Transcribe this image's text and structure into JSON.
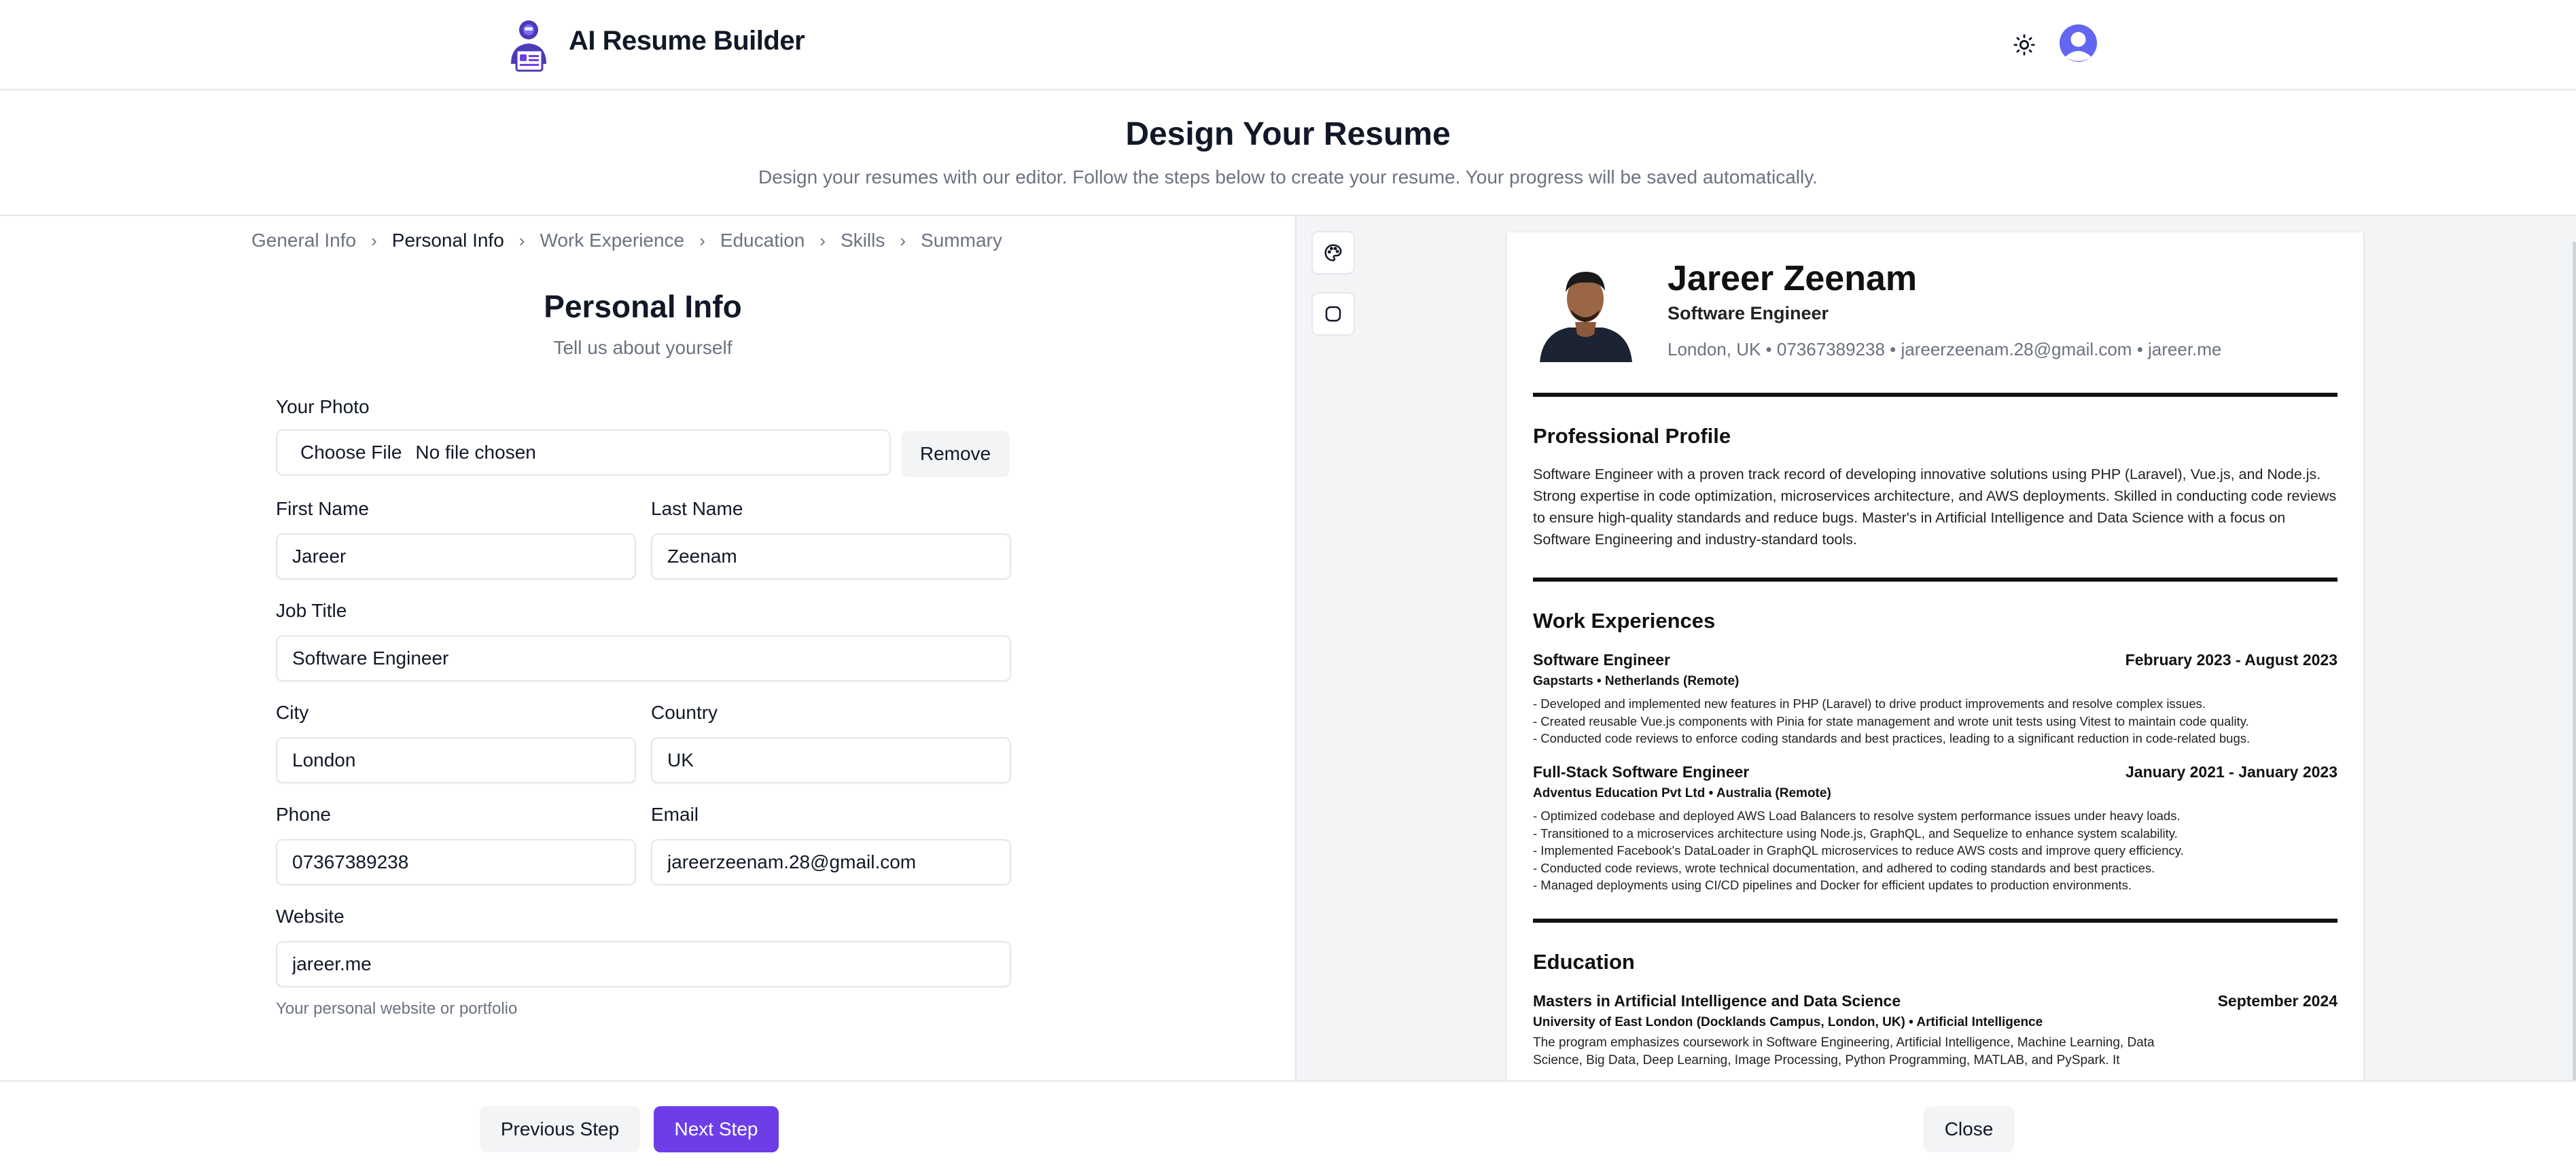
{
  "app": {
    "title": "AI Resume Builder",
    "accent_color": "#6d3ee8",
    "logo_icon": "robot-resume-logo",
    "theme_icon": "sun-icon",
    "avatar_icon": "user-avatar-icon"
  },
  "page": {
    "title": "Design Your Resume",
    "subtitle": "Design your resumes with our editor. Follow the steps below to create your resume. Your progress will be saved automatically."
  },
  "steps": [
    {
      "label": "General Info",
      "active": false
    },
    {
      "label": "Personal Info",
      "active": true
    },
    {
      "label": "Work Experience",
      "active": false
    },
    {
      "label": "Education",
      "active": false
    },
    {
      "label": "Skills",
      "active": false
    },
    {
      "label": "Summary",
      "active": false
    }
  ],
  "step_separator": "›",
  "form": {
    "title": "Personal Info",
    "subtitle": "Tell us about yourself",
    "photo_label": "Your Photo",
    "choose_file": "Choose File",
    "no_file": "No file chosen",
    "remove": "Remove",
    "first_name_label": "First Name",
    "first_name": "Jareer",
    "last_name_label": "Last Name",
    "last_name": "Zeenam",
    "job_title_label": "Job Title",
    "job_title": "Software Engineer",
    "city_label": "City",
    "city": "London",
    "country_label": "Country",
    "country": "UK",
    "phone_label": "Phone",
    "phone": "07367389238",
    "email_label": "Email",
    "email": "jareerzeenam.28@gmail.com",
    "website_label": "Website",
    "website": "jareer.me",
    "website_hint": "Your personal website or portfolio"
  },
  "preview_tools": [
    {
      "icon": "palette-icon"
    },
    {
      "icon": "square-rounded-icon"
    }
  ],
  "resume": {
    "name": "Jareer Zeenam",
    "job_title": "Software Engineer",
    "contact": "London, UK • 07367389238 • jareerzeenam.28@gmail.com • jareer.me",
    "profile_heading": "Professional Profile",
    "profile_text": "Software Engineer with a proven track record of developing innovative solutions using PHP (Laravel), Vue.js, and Node.js. Strong expertise in code optimization, microservices architecture, and AWS deployments. Skilled in conducting code reviews to ensure high-quality standards and reduce bugs. Master's in Artificial Intelligence and Data Science with a focus on Software Engineering and industry-standard tools.",
    "work_heading": "Work Experiences",
    "jobs": [
      {
        "title": "Software Engineer",
        "dates": "February 2023 - August 2023",
        "company": "Gapstarts • Netherlands (Remote)",
        "bullets": [
          "- Developed and implemented new features in PHP (Laravel) to drive product improvements and resolve complex issues.",
          "- Created reusable Vue.js components with Pinia for state management and wrote unit tests using Vitest to maintain code quality.",
          "- Conducted code reviews to enforce coding standards and best practices, leading to a significant reduction in code-related bugs."
        ]
      },
      {
        "title": "Full-Stack Software Engineer",
        "dates": "January 2021 - January 2023",
        "company": "Adventus Education Pvt Ltd • Australia (Remote)",
        "bullets": [
          "- Optimized codebase and deployed AWS Load Balancers to resolve system performance issues under heavy loads.",
          "- Transitioned to a microservices architecture using Node.js, GraphQL, and Sequelize to enhance system scalability.",
          "- Implemented Facebook's DataLoader in GraphQL microservices to reduce AWS costs and improve query efficiency.",
          "- Conducted code reviews, wrote technical documentation, and adhered to coding standards and best practices.",
          "- Managed deployments using CI/CD pipelines and Docker for efficient updates to production environments."
        ]
      }
    ],
    "education_heading": "Education",
    "education": {
      "degree": "Masters in Artificial Intelligence and Data Science",
      "date": "September 2024",
      "school": "University of East London (Docklands Campus, London, UK) • Artificial Intelligence",
      "text": "The program emphasizes coursework in Software Engineering, Artificial Intelligence, Machine Learning, Data Science, Big Data, Deep Learning, Image Processing, Python Programming, MATLAB, and PySpark. It"
    }
  },
  "footer": {
    "previous": "Previous Step",
    "next": "Next Step",
    "close": "Close"
  }
}
